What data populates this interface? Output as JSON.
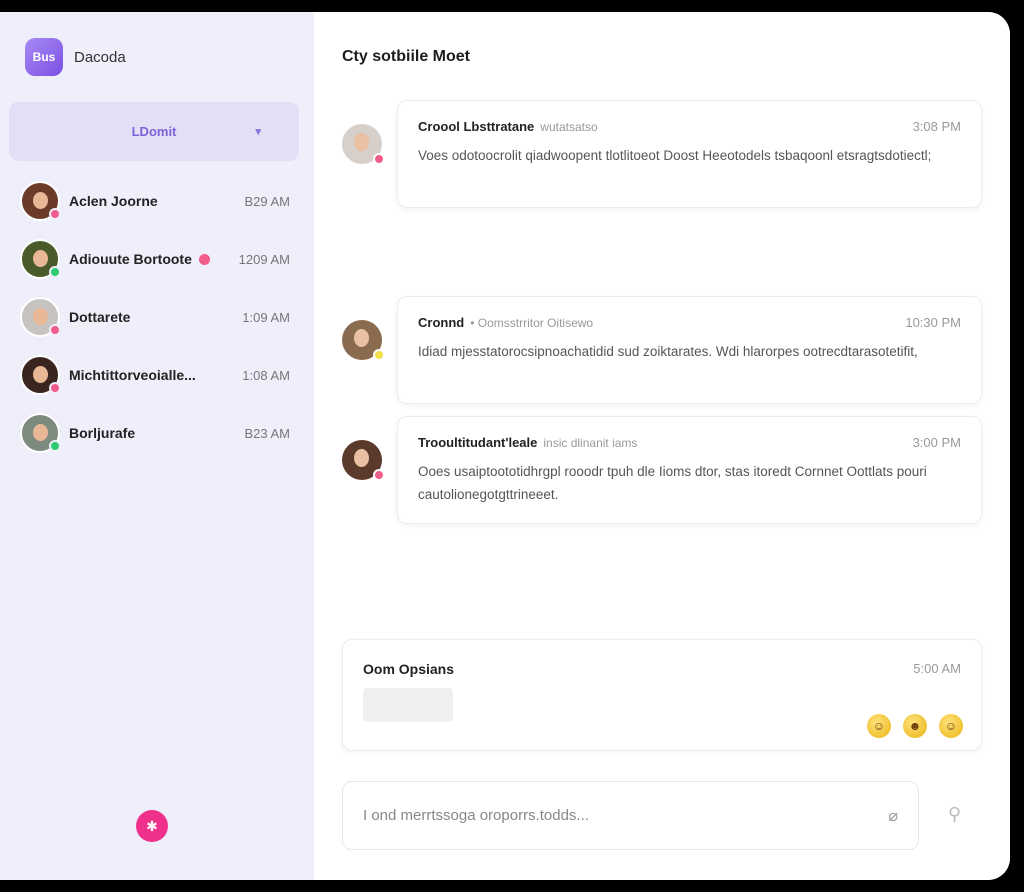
{
  "brand": {
    "logo_text": "Bus",
    "name": "Dacoda"
  },
  "sidebar": {
    "filter": {
      "label": "LDomit",
      "chevron": "▾"
    },
    "contacts": [
      {
        "name": "Aclen Joorne",
        "time": "B29 AM",
        "status_color": "#f25c8a",
        "avatar_bg": "#6b3b2a",
        "unread": false
      },
      {
        "name": "Adiouute Bortoote",
        "time": "1209 AM",
        "status_color": "#2ecc71",
        "avatar_bg": "#4a5a2a",
        "unread": true
      },
      {
        "name": "Dottarete",
        "time": "1:09 AM",
        "status_color": "#f25c8a",
        "avatar_bg": "#c7c3c0",
        "unread": false
      },
      {
        "name": "Michtittorveoialle...",
        "time": "1:08 AM",
        "status_color": "#f25c8a",
        "avatar_bg": "#3a2520",
        "unread": false
      },
      {
        "name": "Borljurafe",
        "time": "B23 AM",
        "status_color": "#2ecc71",
        "avatar_bg": "#7d8a7e",
        "unread": false
      }
    ],
    "fab_icon": "✱"
  },
  "main": {
    "title": "Cty sotbiile Moet",
    "messages": [
      {
        "sender": "Croool Lbsttratane",
        "meta": "wutatsatso",
        "time": "3:08 PM",
        "body": "Voes odotoocrolit qiadwoopent tlotlitoeot Doost Heeotodels tsbaqoonl etsragtsdotiectl;",
        "status_color": "#f25c8a",
        "avatar_bg": "#d7cfc9"
      },
      {
        "sender": "Cronnd",
        "meta": "• Oomsstrritor Oitisewo",
        "time": "10:30 PM",
        "body": "Idiad mjesstatorocsipnoachatidid sud zoiktarates. Wdi hlarorpes ootrecdtarasotetifit,",
        "status_color": "#f1e04a",
        "avatar_bg": "#8a6b4f"
      },
      {
        "sender": "Trooultitudant'leale",
        "meta": "insic dlinanit iams",
        "time": "3:00 PM",
        "body": "Ooes usaiptoototidhrgpl rooodr tpuh dle Iioms dtor, stas itoredt Cornnet Oottlats pouri cautolionegotgttrineeet.",
        "status_color": "#f25c8a",
        "avatar_bg": "#5a3a2a"
      }
    ],
    "compose": {
      "title": "Oom Opsians",
      "time": "5:00 AM",
      "emojis": [
        "☺",
        "☻",
        "☺"
      ]
    },
    "input": {
      "placeholder": "I ond merrtssoga oroporrs.todds...",
      "value": ""
    },
    "attach_icon": "⌀",
    "idea_icon": "⚲"
  }
}
